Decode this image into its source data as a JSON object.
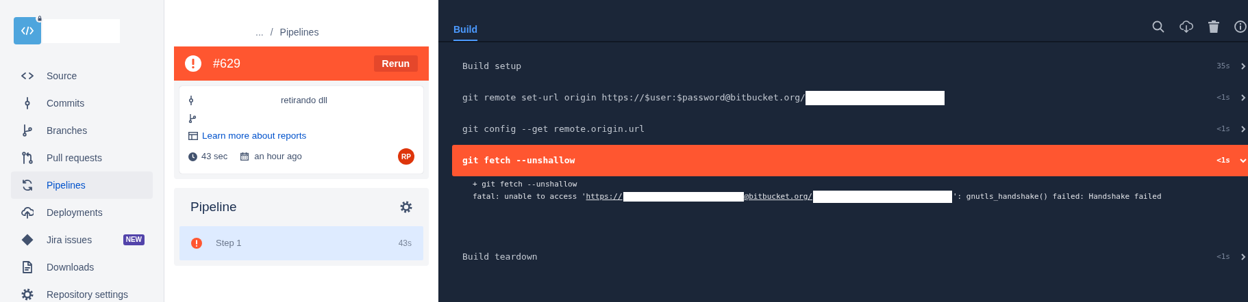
{
  "repository": {
    "name_redacted": true
  },
  "sidebar": {
    "items": [
      {
        "label": "Source",
        "selected": false
      },
      {
        "label": "Commits",
        "selected": false
      },
      {
        "label": "Branches",
        "selected": false
      },
      {
        "label": "Pull requests",
        "selected": false
      },
      {
        "label": "Pipelines",
        "selected": true
      },
      {
        "label": "Deployments",
        "selected": false
      },
      {
        "label": "Jira issues",
        "selected": false,
        "badge": "NEW"
      },
      {
        "label": "Downloads",
        "selected": false
      },
      {
        "label": "Repository settings",
        "selected": false
      }
    ]
  },
  "breadcrumb": {
    "ellipsis": "...",
    "separator": "/",
    "current": "Pipelines"
  },
  "pipeline_header": {
    "failed": true,
    "number": "#629",
    "action": "Rerun"
  },
  "commit": {
    "message": "retirando dll",
    "report_link": "Learn more about reports",
    "duration": "43 sec",
    "time": "an hour ago",
    "avatar": "RP"
  },
  "steps_panel": {
    "title": "Pipeline",
    "steps": [
      {
        "name": "Step 1",
        "duration": "43s",
        "failed": true,
        "selected": true
      }
    ]
  },
  "log": {
    "tabs": [
      {
        "label": "Build",
        "selected": true
      }
    ],
    "sections": [
      {
        "title": "Build setup",
        "duration": "35s",
        "failed": false,
        "expanded": false
      },
      {
        "title": "git remote set-url origin https://$user:$password@bitbucket.org/",
        "redacted": true,
        "duration": "<1s",
        "failed": false,
        "expanded": false
      },
      {
        "title": "git config --get remote.origin.url",
        "duration": "<1s",
        "failed": false,
        "expanded": false
      },
      {
        "title": "git fetch --unshallow",
        "duration": "<1s",
        "failed": true,
        "expanded": true,
        "output": [
          [
            {
              "kind": "text",
              "text": "+ git fetch --unshallow"
            }
          ],
          [
            {
              "kind": "text",
              "text": "fatal: unable to access '"
            },
            {
              "kind": "link",
              "text": "https://"
            },
            {
              "kind": "redacted"
            },
            {
              "kind": "link",
              "text": "@bitbucket.org/"
            },
            {
              "kind": "redacted"
            },
            {
              "kind": "text",
              "text": "': gnutls_handshake() failed: Handshake failed"
            }
          ]
        ]
      },
      {
        "title": "Build teardown",
        "duration": "<1s",
        "failed": false,
        "expanded": false
      }
    ]
  }
}
